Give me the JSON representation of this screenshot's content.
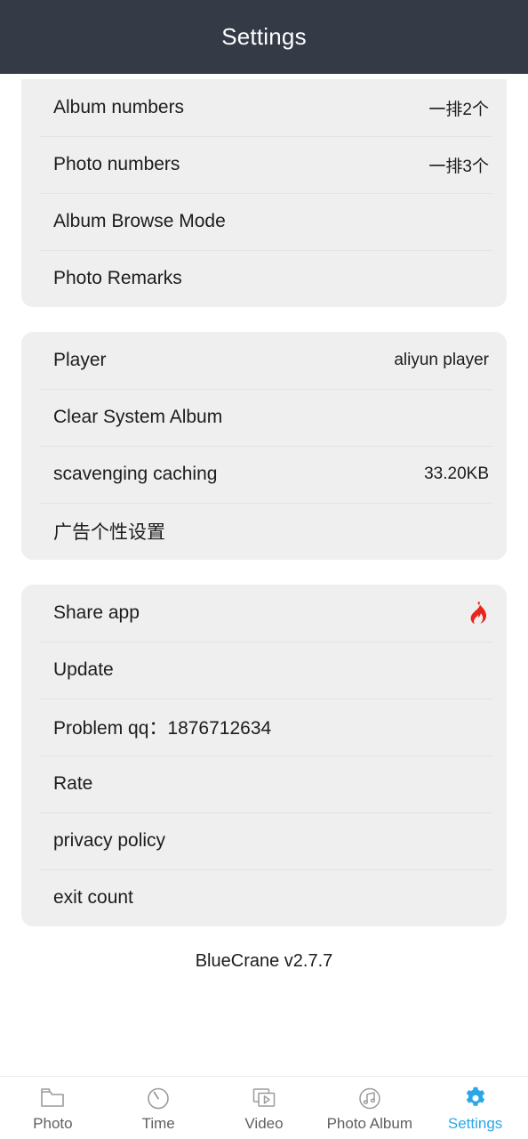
{
  "header": {
    "title": "Settings"
  },
  "sections": [
    {
      "name": "display-settings",
      "rows": [
        {
          "label": "Album numbers",
          "value": "一排2个"
        },
        {
          "label": "Photo numbers",
          "value": "一排3个"
        },
        {
          "label": "Album Browse Mode",
          "value": ""
        },
        {
          "label": "Photo Remarks",
          "value": ""
        }
      ]
    },
    {
      "name": "player-storage-settings",
      "rows": [
        {
          "label": "Player",
          "value": "aliyun player"
        },
        {
          "label": "Clear System Album",
          "value": ""
        },
        {
          "label": "scavenging caching",
          "value": "33.20KB"
        },
        {
          "label": "广告个性设置",
          "value": ""
        }
      ]
    },
    {
      "name": "about-settings",
      "rows": [
        {
          "label": "Share app",
          "value": "",
          "icon": "flame-icon"
        },
        {
          "label": "Update",
          "value": ""
        },
        {
          "label": "Problem qq：1876712634",
          "value": ""
        },
        {
          "label": "Rate",
          "value": ""
        },
        {
          "label": "privacy policy",
          "value": ""
        },
        {
          "label": "exit count",
          "value": ""
        }
      ]
    }
  ],
  "footer": {
    "version": "BlueCrane v2.7.7"
  },
  "tabbar": {
    "active_index": 4,
    "items": [
      {
        "label": "Photo",
        "icon": "folder-icon"
      },
      {
        "label": "Time",
        "icon": "timer-icon"
      },
      {
        "label": "Video",
        "icon": "video-frames-icon"
      },
      {
        "label": "Photo Album",
        "icon": "music-note-circle-icon"
      },
      {
        "label": "Settings",
        "icon": "gear-icon"
      }
    ]
  },
  "colors": {
    "header_bg": "#343a46",
    "card_bg": "#efefef",
    "accent": "#2ba7e8",
    "flame": "#e8241f",
    "icon_inactive": "#9a9a9a"
  }
}
